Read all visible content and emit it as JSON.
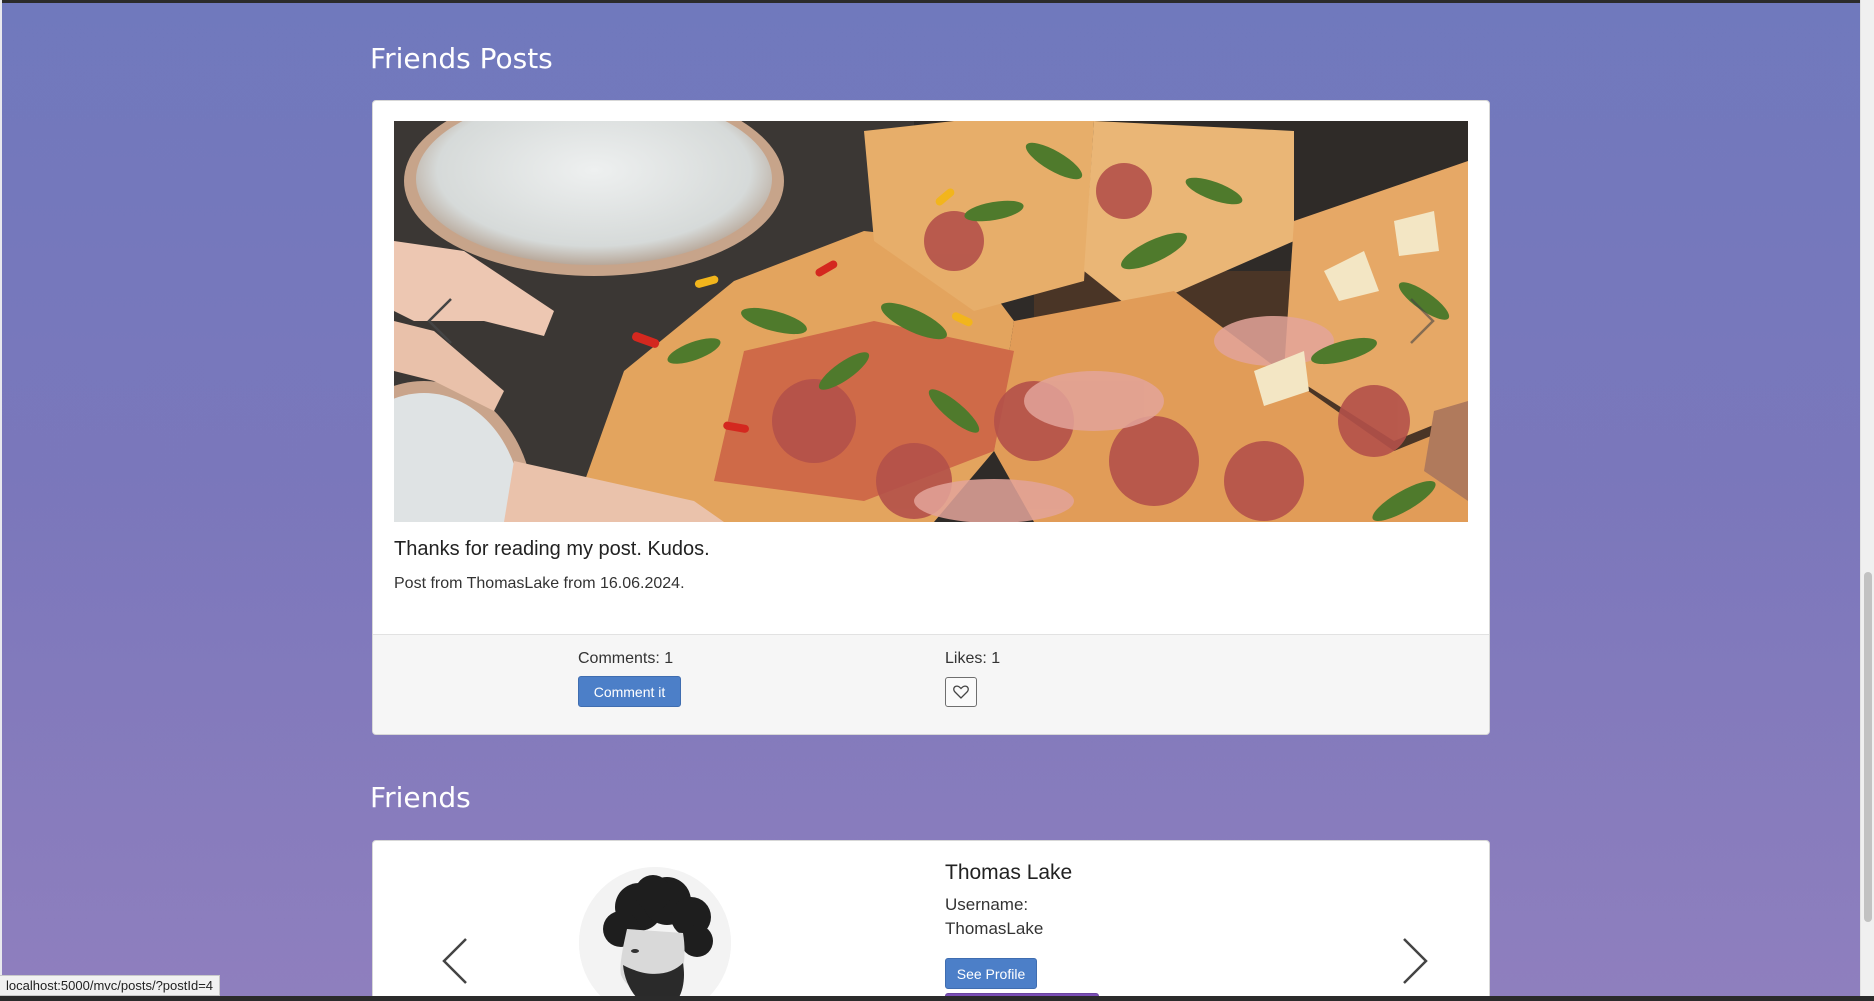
{
  "friends_posts": {
    "section_title": "Friends Posts",
    "post": {
      "title": "Thanks for reading my post. Kudos.",
      "meta": "Post from ThomasLake from 16.06.2024.",
      "comments_label": "Comments: 1",
      "comment_button": "Comment it",
      "likes_label": "Likes: 1"
    }
  },
  "friends": {
    "section_title": "Friends",
    "friend": {
      "name": "Thomas Lake",
      "username_label": "Username:",
      "username_value": "ThomasLake",
      "see_profile_button": "See Profile"
    }
  },
  "status_bar": {
    "url": "localhost:5000/mvc/posts/?postId=4"
  },
  "colors": {
    "background_top": "#7079bd",
    "background_bottom": "#8f7fbe",
    "primary_button": "#4c7fc8"
  },
  "icons": {
    "carousel_prev": "chevron-left-icon",
    "carousel_next": "chevron-right-icon",
    "like": "heart-outline-icon"
  }
}
